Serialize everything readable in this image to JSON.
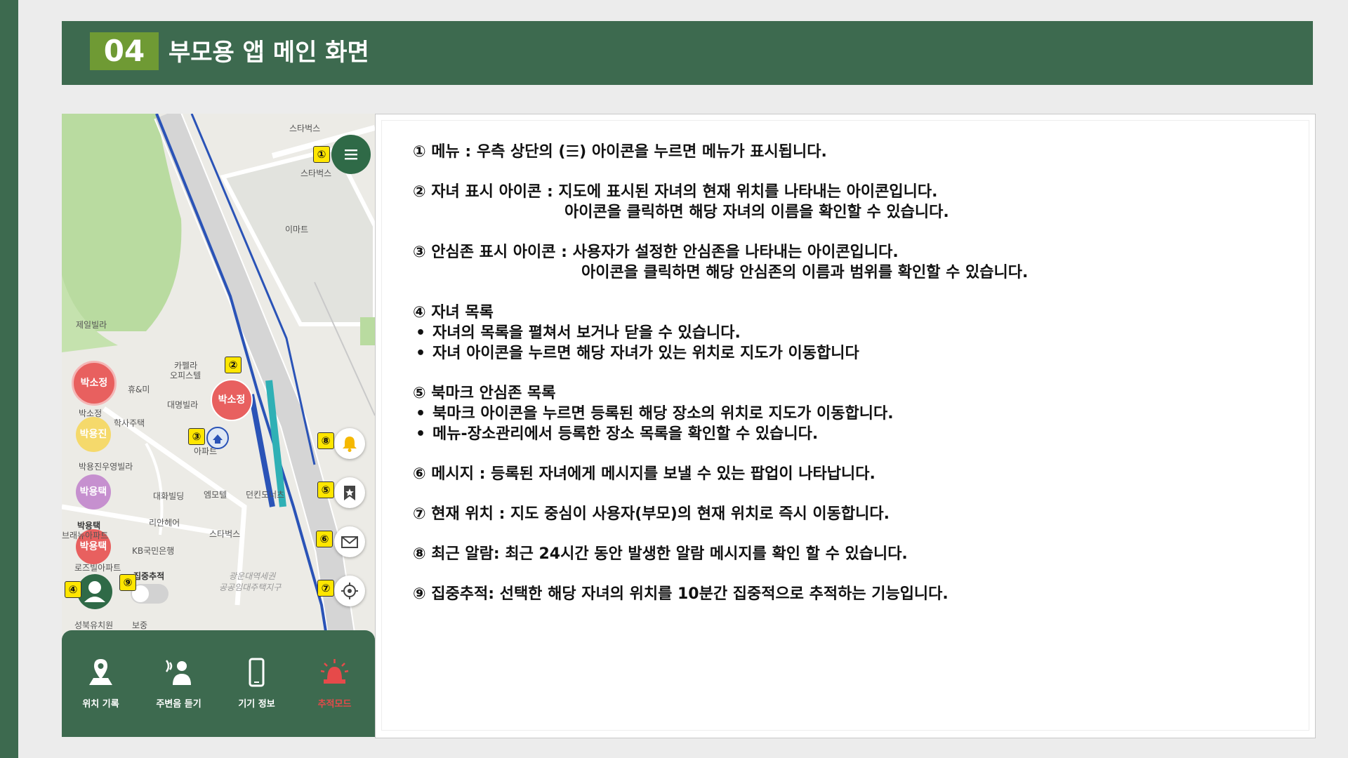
{
  "header": {
    "number": "04",
    "title": "부모용 앱 메인 화면"
  },
  "map": {
    "labels": [
      "스타벅스",
      "스타벅스",
      "이마트",
      "제일빌라",
      "카펠라",
      "오피스텔",
      "휴&미",
      "박소정",
      "학사주택",
      "대명빌라",
      "아파트",
      "박용진우영빌라",
      "대화빌딩",
      "엠모텔",
      "던킨도너츠",
      "리안헤어",
      "스타벅스",
      "KB국민은행",
      "로즈빌아파트",
      "광운대역세권",
      "공공임대주택지구",
      "성북유치원",
      "보중",
      "집중추적"
    ],
    "markers": [
      {
        "name": "박소정",
        "color": "#e8605f"
      },
      {
        "name": "박용진",
        "color": "#f5d96b"
      },
      {
        "name": "박용택",
        "color": "#c690cf"
      },
      {
        "name": "박용택",
        "color": "#e8605f"
      },
      {
        "name": "박소정",
        "color": "#e8605f"
      }
    ],
    "below_labels": [
      "박소정",
      "박용택",
      "브래뉴아파트"
    ],
    "badges": [
      "①",
      "②",
      "③",
      "④",
      "⑤",
      "⑥",
      "⑦",
      "⑧",
      "⑨"
    ]
  },
  "nav": [
    {
      "label": "위치 기록",
      "icon": "location-person-icon",
      "active": false
    },
    {
      "label": "주변음 듣기",
      "icon": "listen-icon",
      "active": false
    },
    {
      "label": "기기 정보",
      "icon": "phone-icon",
      "active": false
    },
    {
      "label": "추적모드",
      "icon": "siren-icon",
      "active": true
    }
  ],
  "colors": {
    "brand": "#3d6a4f",
    "accent": "#6f9a34",
    "active": "#e64a4a",
    "badge": "#ffe600"
  },
  "descriptions": [
    {
      "kind": "line",
      "text": "① 메뉴 : 우측 상단의 (☰) 아이콘을 누르면 메뉴가 표시됩니다."
    },
    {
      "kind": "line",
      "text": "② 자녀 표시 아이콘 : 지도에 표시된 자녀의 현재 위치를 나타내는 아이콘입니다."
    },
    {
      "kind": "line",
      "text": "아이콘을 클릭하면 해당 자녀의 이름을 확인할 수 있습니다."
    },
    {
      "kind": "line",
      "text": "③ 안심존 표시 아이콘 : 사용자가 설정한 안심존을 나타내는 아이콘입니다."
    },
    {
      "kind": "line",
      "text": "아이콘을 클릭하면 해당 안심존의 이름과 범위를 확인할 수 있습니다."
    },
    {
      "kind": "line",
      "text": "④ 자녀 목록"
    },
    {
      "kind": "bullet",
      "text": "자녀의 목록을 펼쳐서 보거나 닫을 수 있습니다."
    },
    {
      "kind": "bullet",
      "text": "자녀 아이콘을 누르면 해당 자녀가 있는 위치로 지도가 이동합니다"
    },
    {
      "kind": "line",
      "text": "⑤ 북마크 안심존 목록"
    },
    {
      "kind": "bullet",
      "text": "북마크 아이콘을 누르면 등록된 해당 장소의 위치로 지도가 이동합니다."
    },
    {
      "kind": "bullet",
      "text": "메뉴-장소관리에서 등록한 장소 목록을 확인할 수 있습니다."
    },
    {
      "kind": "line",
      "text": "⑥ 메시지 : 등록된 자녀에게 메시지를 보낼 수 있는 팝업이 나타납니다."
    },
    {
      "kind": "line",
      "text": "⑦ 현재 위치 : 지도 중심이 사용자(부모)의 현재 위치로 즉시 이동합니다."
    },
    {
      "kind": "line",
      "text": "⑧ 최근 알람: 최근 24시간 동안 발생한 알람 메시지를 확인 할 수 있습니다."
    },
    {
      "kind": "line",
      "text": "⑨ 집중추적: 선택한 해당 자녀의 위치를 10분간 집중적으로 추적하는 기능입니다."
    }
  ],
  "bullet_symbol": "•"
}
